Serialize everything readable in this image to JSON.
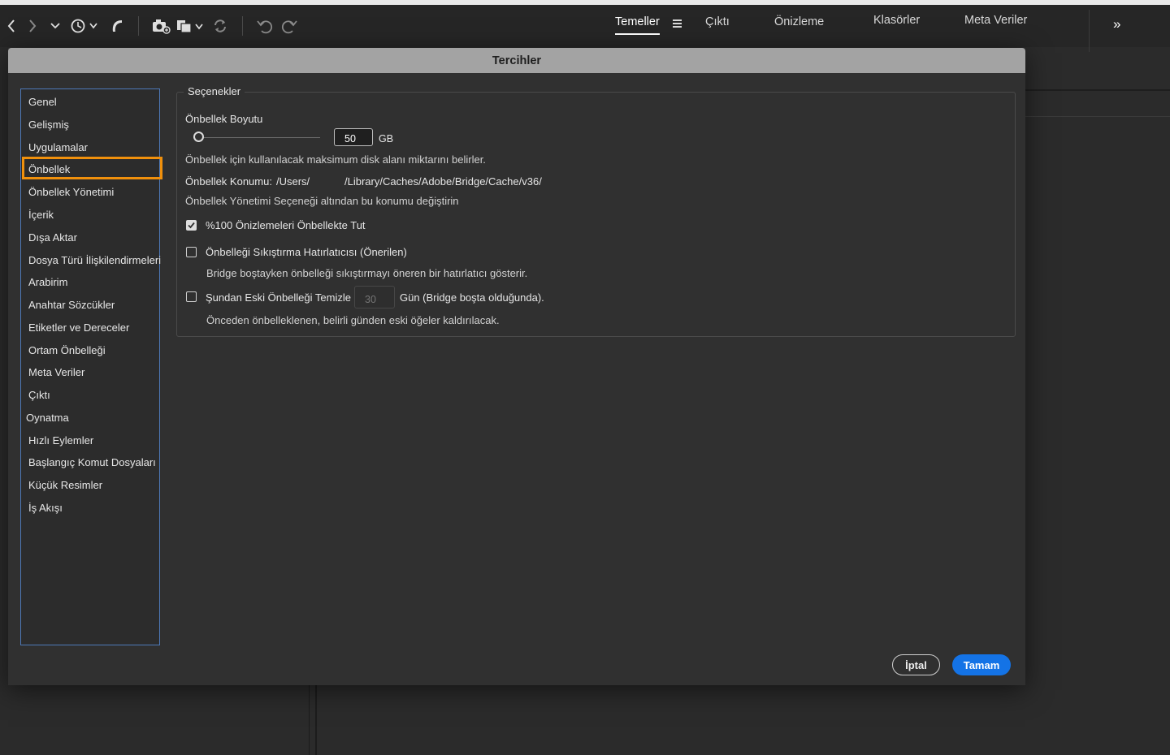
{
  "toolbar": {
    "icons": [
      "back-icon",
      "forward-icon",
      "chevron-down-icon",
      "recent-history-icon",
      "boomerang-icon",
      "camera-import-icon",
      "refine-stack-icon",
      "sync-icon",
      "undo-icon",
      "redo-icon"
    ]
  },
  "workspaces": {
    "tabs": [
      "Temeller",
      "Çıktı",
      "Önizleme",
      "Klasörler",
      "Meta Veriler"
    ],
    "active": "Temeller",
    "overflow": "»"
  },
  "dialog": {
    "title": "Tercihler",
    "categories": [
      "Genel",
      "Gelişmiş",
      "Uygulamalar",
      "Önbellek",
      "Önbellek Yönetimi",
      "İçerik",
      "Dışa Aktar",
      "Dosya Türü İlişkilendirmeleri",
      "Arabirim",
      "Anahtar Sözcükler",
      "Etiketler ve Dereceler",
      "Ortam Önbelleği",
      "Meta Veriler",
      "Çıktı",
      "Oynatma",
      "Hızlı Eylemler",
      "Başlangıç Komut Dosyaları",
      "Küçük Resimler",
      "İş Akışı"
    ],
    "selected_category": "Önbellek",
    "group_title": "Seçenekler",
    "cache_size": {
      "label": "Önbellek Boyutu",
      "value": "50",
      "unit": "GB",
      "slider_level": 0.0,
      "description": "Önbellek için kullanılacak maksimum disk alanı miktarını belirler."
    },
    "cache_location": {
      "label": "Önbellek Konumu:",
      "path_prefix": "/Users/",
      "path_suffix": "/Library/Caches/Adobe/Bridge/Cache/v36/",
      "note": "Önbellek Yönetimi Seçeneği altından bu konumu değiştirin"
    },
    "keep_previews": {
      "label": "%100 Önizlemeleri Önbellekte Tut",
      "checked": true
    },
    "compact_reminder": {
      "label": "Önbelleği Sıkıştırma Hatırlatıcısı (Önerilen)",
      "checked": false,
      "description": "Bridge boştayken önbelleği sıkıştırmayı öneren bir hatırlatıcı gösterir."
    },
    "purge_older": {
      "label": "Şundan Eski Önbelleği Temizle",
      "days_placeholder": "30",
      "suffix": "Gün (Bridge boşta olduğunda).",
      "checked": false,
      "description": "Önceden önbelleklenen, belirli günden eski öğeler kaldırılacak."
    },
    "buttons": {
      "cancel": "İptal",
      "ok": "Tamam"
    },
    "colors": {
      "highlight": "#f0900c",
      "primary": "#1473e6",
      "list_border": "#4e79b8"
    }
  }
}
